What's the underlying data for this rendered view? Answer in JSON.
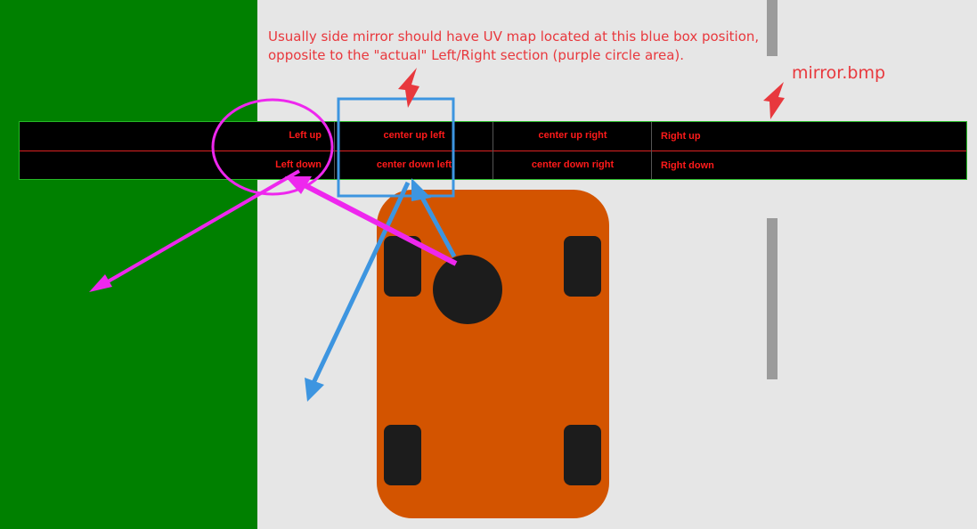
{
  "note": {
    "line1": "Usually side mirror should have UV map located at this blue box position,",
    "line2": "opposite to the \"actual\" Left/Right section (purple circle area)."
  },
  "file_label": "mirror.bmp",
  "uv_strip": {
    "cells": {
      "left_up": "Left up",
      "left_down": "Left down",
      "center_up_left": "center up left",
      "center_down_left": "center down left",
      "center_up_right": "center up right",
      "center_down_right": "center down right",
      "right_up": "Right up",
      "right_down": "Right down"
    }
  },
  "colors": {
    "field": "#008000",
    "road": "#e6e6e6",
    "car_body": "#d35400",
    "car_parts": "#1c1c1c",
    "purple": "#ee27ee",
    "blue": "#3d95e0",
    "red_text": "#e8383d"
  }
}
